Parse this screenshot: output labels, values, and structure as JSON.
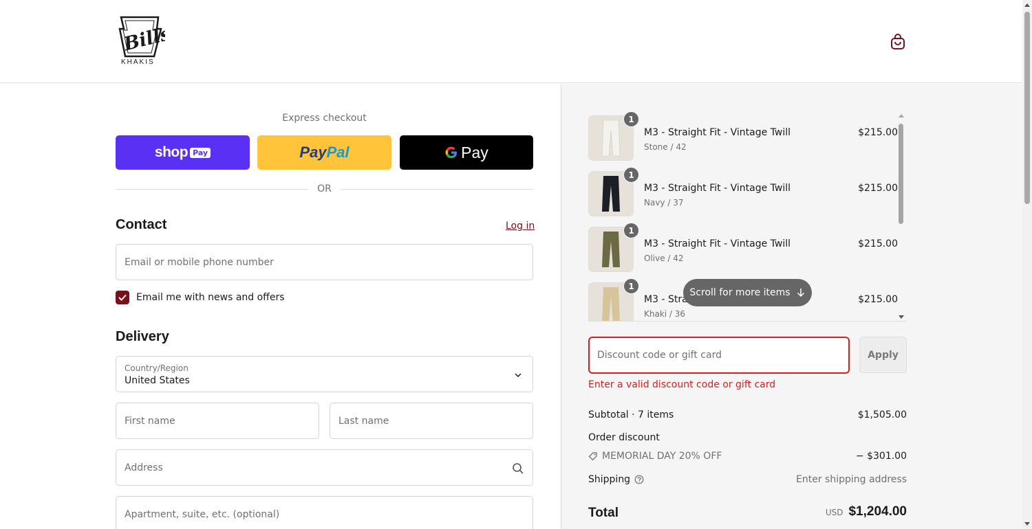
{
  "brand": {
    "logo_script": "Bills",
    "logo_word": "KHAKIS"
  },
  "header": {
    "cart_icon": "shopping-bag-icon"
  },
  "express": {
    "label": "Express checkout",
    "shop_pay": {
      "word": "shop",
      "chip": "Pay"
    },
    "paypal": {
      "part1": "Pay",
      "part2": "Pal"
    },
    "gpay": {
      "g": "G",
      "word": "Pay"
    },
    "or_label": "OR"
  },
  "contact": {
    "title": "Contact",
    "login_link": "Log in",
    "email_placeholder": "Email or mobile phone number",
    "newsletter_label": "Email me with news and offers",
    "newsletter_checked": true
  },
  "delivery": {
    "title": "Delivery",
    "country_label": "Country/Region",
    "country_value": "United States",
    "first_name_placeholder": "First name",
    "last_name_placeholder": "Last name",
    "address_placeholder": "Address",
    "apartment_placeholder": "Apartment, suite, etc. (optional)"
  },
  "order": {
    "items": [
      {
        "qty": "1",
        "name": "M3 - Straight Fit - Vintage Twill",
        "variant": "Stone / 42",
        "price": "$215.00",
        "color": "#f3f2ee"
      },
      {
        "qty": "1",
        "name": "M3 - Straight Fit - Vintage Twill",
        "variant": "Navy / 37",
        "price": "$215.00",
        "color": "#1c1f26"
      },
      {
        "qty": "1",
        "name": "M3 - Straight Fit - Vintage Twill",
        "variant": "Olive / 42",
        "price": "$215.00",
        "color": "#6b6a45"
      },
      {
        "qty": "1",
        "name": "M3 - Straight Fit - Vintage Twill",
        "variant": "Khaki / 36",
        "price": "$215.00",
        "color": "#d7c49a"
      }
    ],
    "scroll_hint": "Scroll for more items",
    "discount_placeholder": "Discount code or gift card",
    "apply_label": "Apply",
    "discount_error": "Enter a valid discount code or gift card",
    "subtotal_label": "Subtotal · 7 items",
    "subtotal_value": "$1,505.00",
    "order_discount_label": "Order discount",
    "discount_code": "MEMORIAL DAY 20% OFF",
    "discount_value": "− $301.00",
    "shipping_label": "Shipping",
    "shipping_value": "Enter shipping address",
    "total_label": "Total",
    "currency": "USD",
    "total_value": "$1,204.00"
  },
  "colors": {
    "accent": "#7b0f1c",
    "error": "#dd1d1d",
    "shop_pay": "#5a31f4",
    "paypal": "#ffc439"
  }
}
